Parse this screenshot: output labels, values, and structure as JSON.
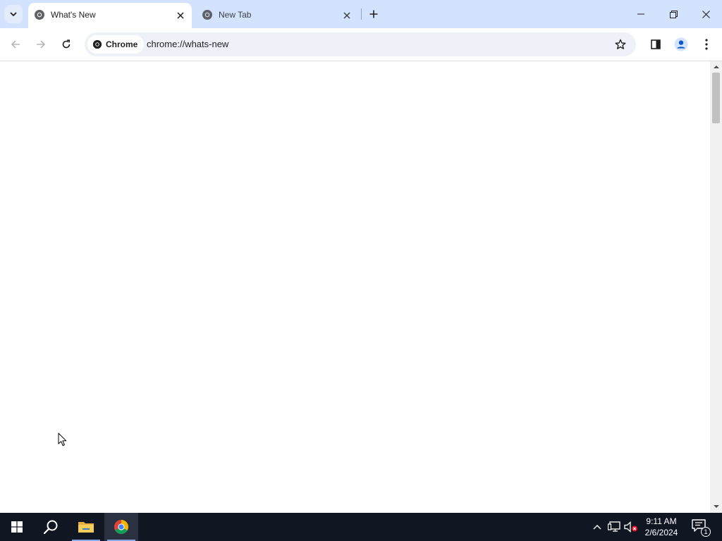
{
  "browser": {
    "tabs": [
      {
        "title": "What's New",
        "active": true,
        "favicon": "chrome-icon"
      },
      {
        "title": "New Tab",
        "active": false,
        "favicon": "chrome-icon"
      }
    ],
    "omnibox": {
      "chip_label": "Chrome",
      "url": "chrome://whats-new"
    },
    "window_controls": [
      "minimize-icon",
      "restore-icon",
      "close-icon"
    ],
    "toolbar_icons": [
      "back-arrow-icon",
      "forward-arrow-icon",
      "reload-icon",
      "bookmark-star-icon",
      "side-panel-icon",
      "profile-icon",
      "more-menu-icon"
    ]
  },
  "page": {
    "background": "#ffffff"
  },
  "taskbar": {
    "apps": [
      "start-icon",
      "search-icon",
      "file-explorer-icon",
      "chrome-icon"
    ],
    "active_app": "chrome-icon",
    "clock": {
      "time": "9:11 AM",
      "date": "2/6/2024"
    },
    "notification_count": "1"
  },
  "colors": {
    "tabstrip": "#d3e3fd",
    "omnibox": "#eef1f8",
    "taskbar": "#101622",
    "accent": "#0b57d0"
  }
}
